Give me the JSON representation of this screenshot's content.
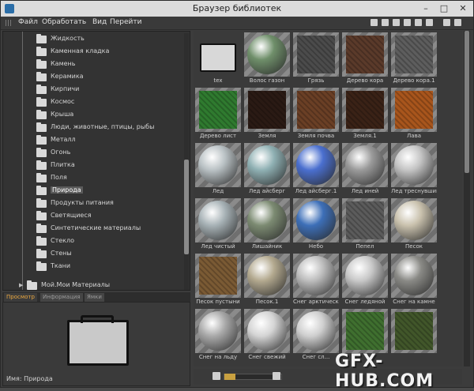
{
  "window": {
    "title": "Браузер библиотек",
    "controls": [
      "–",
      "□",
      "✕"
    ]
  },
  "menu": {
    "items": [
      "Файл",
      "Обработать",
      "Вид",
      "Перейти"
    ]
  },
  "toolbar_icons": [
    "layout-icon",
    "new-icon",
    "grid-icon",
    "book-icon",
    "bookmark-icon",
    "back-icon",
    "list-icon",
    "tile-icon"
  ],
  "tree": {
    "items": [
      {
        "label": "Жидкость",
        "icon": "folder-icon"
      },
      {
        "label": "Каменная кладка",
        "icon": "folder-icon"
      },
      {
        "label": "Камень",
        "icon": "folder-icon"
      },
      {
        "label": "Керамика",
        "icon": "folder-icon"
      },
      {
        "label": "Кирпичи",
        "icon": "folder-icon"
      },
      {
        "label": "Космос",
        "icon": "folder-icon"
      },
      {
        "label": "Крыша",
        "icon": "folder-icon"
      },
      {
        "label": "Люди, животные, птицы, рыбы",
        "icon": "folder-icon"
      },
      {
        "label": "Металл",
        "icon": "folder-icon"
      },
      {
        "label": "Огонь",
        "icon": "folder-icon"
      },
      {
        "label": "Плитка",
        "icon": "folder-icon"
      },
      {
        "label": "Поля",
        "icon": "folder-icon"
      },
      {
        "label": "Природа",
        "icon": "folder-icon",
        "selected": true
      },
      {
        "label": "Продукты питания",
        "icon": "folder-icon"
      },
      {
        "label": "Светящиеся",
        "icon": "folder-icon"
      },
      {
        "label": "Синтетические материалы",
        "icon": "folder-icon"
      },
      {
        "label": "Стекло",
        "icon": "folder-icon"
      },
      {
        "label": "Стены",
        "icon": "folder-icon"
      },
      {
        "label": "Ткани",
        "icon": "folder-icon"
      }
    ],
    "root_items": [
      {
        "label": "Мой.Мои Материалы"
      }
    ]
  },
  "tabs": [
    "Просмотр",
    "Информация",
    "Ямки"
  ],
  "preview": {
    "name_label": "Имя: Природа"
  },
  "grid": {
    "tiles": [
      {
        "label": "tex",
        "kind": "folder"
      },
      {
        "label": "Волос газон",
        "kind": "sphere",
        "color": "#6f8f6a"
      },
      {
        "label": "Грязь",
        "kind": "square",
        "color": "#4b4b4b"
      },
      {
        "label": "Дерево кора",
        "kind": "square",
        "color": "#5a3a2a"
      },
      {
        "label": "Дерево кора.1",
        "kind": "square",
        "color": "#5d5d5d"
      },
      {
        "label": "Дерево лист",
        "kind": "square",
        "color": "#2f7a2f"
      },
      {
        "label": "Земля",
        "kind": "square",
        "color": "#2a1a14"
      },
      {
        "label": "Земля почва",
        "kind": "square",
        "color": "#6a3f25"
      },
      {
        "label": "Земля.1",
        "kind": "square",
        "color": "#3a2216"
      },
      {
        "label": "Лава",
        "kind": "square",
        "color": "#a8551c"
      },
      {
        "label": "Лед",
        "kind": "sphere",
        "color": "#b9c1c4"
      },
      {
        "label": "Лед айсберг",
        "kind": "sphere",
        "color": "#8fb0b3"
      },
      {
        "label": "Лед айсберг.1",
        "kind": "sphere",
        "color": "#4a6fcf"
      },
      {
        "label": "Лед иней",
        "kind": "sphere",
        "color": "#9a9a9a"
      },
      {
        "label": "Лед треснувший",
        "kind": "sphere",
        "color": "#c4c4c4"
      },
      {
        "label": "Лед чистый",
        "kind": "sphere",
        "color": "#a7b2b6"
      },
      {
        "label": "Лишайник",
        "kind": "sphere",
        "color": "#7c8b72"
      },
      {
        "label": "Небо",
        "kind": "sphere",
        "color": "#3d6fb8"
      },
      {
        "label": "Пепел",
        "kind": "square",
        "color": "#5b5b5b"
      },
      {
        "label": "Песок",
        "kind": "sphere",
        "color": "#c9c1ad"
      },
      {
        "label": "Песок пустыни",
        "kind": "square",
        "color": "#7a5a34"
      },
      {
        "label": "Песок.1",
        "kind": "sphere",
        "color": "#b3a98f"
      },
      {
        "label": "Снег арктический",
        "kind": "sphere",
        "color": "#bdbdbd"
      },
      {
        "label": "Снег ледяной",
        "kind": "sphere",
        "color": "#c8c8c8"
      },
      {
        "label": "Снег на камне",
        "kind": "sphere",
        "color": "#8a8a86"
      },
      {
        "label": "Снег на льду",
        "kind": "sphere",
        "color": "#a9a9a9"
      },
      {
        "label": "Снег свежий",
        "kind": "sphere",
        "color": "#d4d4d4"
      },
      {
        "label": "Снег сл...",
        "kind": "sphere",
        "color": "#cfcfcf"
      },
      {
        "label": "",
        "kind": "square",
        "color": "#3f6f2f"
      },
      {
        "label": "",
        "kind": "square",
        "color": "#41562a"
      }
    ]
  },
  "watermark": "GFX-HUB.COM"
}
